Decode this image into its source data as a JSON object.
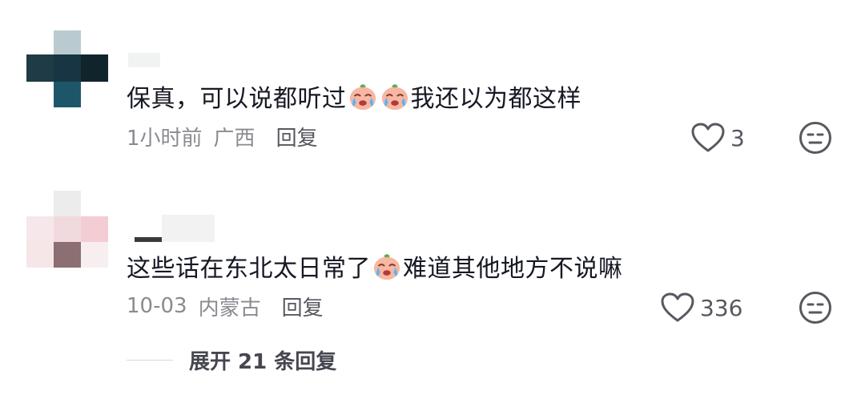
{
  "comments": [
    {
      "text_before": "保真，可以说都听过",
      "text_after": "我还以为都这样",
      "time": "1小时前",
      "location": "广西",
      "reply_label": "回复",
      "like_count": "3",
      "emoji": "crying-face-emoji"
    },
    {
      "text_before": "这些话在东北太日常了",
      "text_after": "难道其他地方不说嘛",
      "time": "10-03",
      "location": "内蒙古",
      "reply_label": "回复",
      "like_count": "336",
      "emoji": "crying-face-emoji"
    }
  ],
  "expand_replies": {
    "label": "展开 21 条回复"
  },
  "colors": {
    "text": "#161823",
    "meta": "#8a8b91",
    "icon": "#575860"
  }
}
